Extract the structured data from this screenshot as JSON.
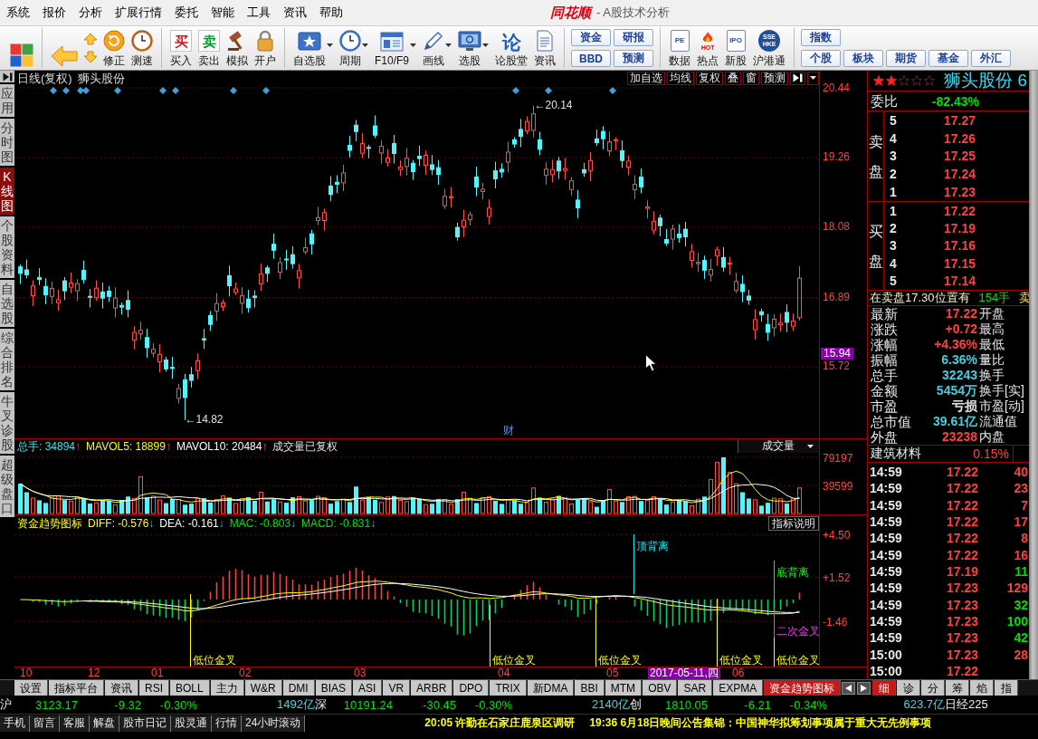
{
  "title_bar": {
    "logo": "同花顺",
    "title": "- A股技术分析"
  },
  "menu": [
    "系统",
    "报价",
    "分析",
    "扩展行情",
    "委托",
    "智能",
    "工具",
    "资讯",
    "帮助"
  ],
  "toolbar": [
    [
      {
        "kind": "icon"
      }
    ],
    [
      {
        "kind": "icon"
      },
      {
        "kind": "arrows"
      },
      {
        "kind": "labeled",
        "label": "修正",
        "caret": false
      },
      {
        "kind": "labeled",
        "label": "测速",
        "caret": false
      }
    ],
    [
      {
        "kind": "glyph",
        "glyph": "买",
        "label": "买入",
        "caret": false
      },
      {
        "kind": "glyph",
        "glyph": "卖",
        "label": "卖出",
        "caret": false
      },
      {
        "kind": "labeled",
        "label": "模拟",
        "caret": false
      },
      {
        "kind": "labeled",
        "label": "开户",
        "caret": false
      }
    ],
    [
      {
        "kind": "labeled",
        "label": "自选股",
        "caret": true
      },
      {
        "kind": "labeled",
        "label": "周期",
        "caret": true
      },
      {
        "kind": "labeled",
        "label": "F10/F9",
        "caret": true
      },
      {
        "kind": "labeled",
        "label": "画线",
        "caret": true
      },
      {
        "kind": "labeled",
        "label": "选股",
        "caret": true
      },
      {
        "kind": "glyph",
        "glyph": "论",
        "label": "论股堂",
        "caret": false
      },
      {
        "kind": "labeled",
        "label": "资讯",
        "caret": false
      }
    ],
    [
      {
        "kind": "pair",
        "labels": [
          "资金",
          "BBD"
        ]
      },
      {
        "kind": "pair",
        "labels": [
          "研报",
          "预测"
        ]
      }
    ],
    [
      {
        "kind": "glyph",
        "glyph": "PE",
        "label": "数据",
        "caret": false
      },
      {
        "kind": "glyph",
        "glyph": "HOT",
        "label": "热点",
        "caret": false
      },
      {
        "kind": "glyph",
        "glyph": "IPO",
        "label": "新股",
        "caret": false
      },
      {
        "kind": "glyph",
        "glyph": "SSE HKE",
        "label": "沪港通",
        "caret": false
      }
    ],
    [
      {
        "kind": "pair",
        "labels": [
          "指数",
          "个股"
        ]
      },
      {
        "kind": "text",
        "label": "板块"
      },
      {
        "kind": "text",
        "label": "期货"
      },
      {
        "kind": "text",
        "label": "基金"
      },
      {
        "kind": "text",
        "label": "外汇"
      }
    ]
  ],
  "sidebar": [
    {
      "label": "应用",
      "selected": false
    },
    {
      "label": "分时图",
      "selected": false
    },
    {
      "label": "K线图",
      "selected": true
    },
    {
      "label": "个股资料",
      "selected": false
    },
    {
      "label": "自选股",
      "selected": false
    },
    {
      "label": "综合排名",
      "selected": false
    },
    {
      "label": "牛叉诊股",
      "selected": false
    },
    {
      "label": "超级盘口",
      "selected": false
    }
  ],
  "chart": {
    "period": "日线(复权)",
    "stock": "狮头股份",
    "buttons": [
      "加自选",
      "均线",
      "复权",
      "叠",
      "窗",
      "预测"
    ],
    "price_ticks": [
      "20.44",
      "19.26",
      "18.08",
      "16.89",
      "15.72"
    ],
    "cursor_price": "15.94",
    "high_label": "←20.14",
    "low_label": "←14.82",
    "event_marker": "财"
  },
  "volume": {
    "legend": [
      {
        "text": "总手: 34894",
        "arrow": "↑",
        "color": "#40e0e8"
      },
      {
        "text": "MAVOL5: 18899",
        "arrow": "↑",
        "color": "#ffff00"
      },
      {
        "text": "MAVOL10: 20484",
        "arrow": "↑",
        "color": "#ffffff"
      }
    ],
    "note": "成交量已复权",
    "selector": "成交量",
    "ticks": [
      "79197",
      "39599"
    ]
  },
  "indicator": {
    "title": "资金趋势图标",
    "legend": [
      {
        "text": "DIFF: -0.576",
        "arrow": "↓",
        "color": "#ffff00"
      },
      {
        "text": "DEA: -0.161",
        "arrow": "↓",
        "color": "#ffffff"
      },
      {
        "text": "MAC: -0.803",
        "arrow": "↓",
        "color": "#00e000"
      },
      {
        "text": "MACD: -0.831",
        "arrow": "↓",
        "color": "#00e000"
      }
    ],
    "help": "指标说明",
    "ticks": [
      "+4.50",
      "+1.52",
      "-1.46"
    ],
    "signals": [
      {
        "kind": "low-golden-cross",
        "label": "低位金叉"
      },
      {
        "kind": "low-golden-cross",
        "label": "低位金叉"
      },
      {
        "kind": "low-golden-cross",
        "label": "低位金叉"
      },
      {
        "kind": "top-divergence",
        "label": "顶背离"
      },
      {
        "kind": "low-golden-cross",
        "label": "低位金叉"
      },
      {
        "kind": "bottom-divergence",
        "label": "底背离"
      },
      {
        "kind": "second-golden-cross",
        "label": "二次金叉"
      },
      {
        "kind": "low-golden-cross",
        "label": "低位金叉"
      }
    ]
  },
  "x_axis": {
    "labels": [
      "10",
      "12",
      "01",
      "02",
      "03",
      "04",
      "05",
      "06"
    ],
    "cursor_date": "2017-05-11,四"
  },
  "quote": {
    "stars": 2,
    "name": "狮头股份 6",
    "order_ratio": {
      "label": "委比",
      "value": "-82.43%"
    },
    "asks": {
      "label": "卖盘",
      "rows": [
        {
          "rank": "5",
          "price": "17.27"
        },
        {
          "rank": "4",
          "price": "17.26"
        },
        {
          "rank": "3",
          "price": "17.25"
        },
        {
          "rank": "2",
          "price": "17.24"
        },
        {
          "rank": "1",
          "price": "17.23"
        }
      ]
    },
    "bids": {
      "label": "买盘",
      "rows": [
        {
          "rank": "1",
          "price": "17.22"
        },
        {
          "rank": "2",
          "price": "17.19"
        },
        {
          "rank": "3",
          "price": "17.16"
        },
        {
          "rank": "4",
          "price": "17.15"
        },
        {
          "rank": "5",
          "price": "17.14"
        }
      ]
    },
    "queue": {
      "text": "在卖盘17.30位置有",
      "volume": "154手",
      "side": "卖"
    },
    "stats": [
      {
        "label": "最新",
        "value": "17.22",
        "color": "#ff4040",
        "extra": "开盘"
      },
      {
        "label": "涨跌",
        "value": "+0.72",
        "color": "#ff4040",
        "extra": "最高"
      },
      {
        "label": "涨幅",
        "value": "+4.36%",
        "color": "#ff4040",
        "extra": "最低"
      },
      {
        "label": "振幅",
        "value": "6.36%",
        "color": "#40d0e0",
        "extra": "量比"
      },
      {
        "label": "总手",
        "value": "32243",
        "color": "#40d0e0",
        "extra": "换手"
      },
      {
        "label": "金额",
        "value": "5454万",
        "color": "#40d0e0",
        "extra": "换手[实]"
      },
      {
        "label": "市盈",
        "value": "亏损",
        "color": "#e8e8e8",
        "extra": "市盈[动]"
      },
      {
        "label": "总市值",
        "value": "39.61亿",
        "color": "#40d0e0",
        "extra": "流通值"
      },
      {
        "label": "外盘",
        "value": "23238",
        "color": "#ff4040",
        "extra": "内盘"
      }
    ],
    "sector": {
      "name": "建筑材料",
      "change": "0.15%"
    },
    "ticks": [
      {
        "time": "14:59",
        "price": "17.22",
        "volume": "40",
        "color": "#ff4040"
      },
      {
        "time": "14:59",
        "price": "17.22",
        "volume": "23",
        "color": "#ff4040"
      },
      {
        "time": "14:59",
        "price": "17.22",
        "volume": "7",
        "color": "#ff4040"
      },
      {
        "time": "14:59",
        "price": "17.22",
        "volume": "17",
        "color": "#ff4040"
      },
      {
        "time": "14:59",
        "price": "17.22",
        "volume": "8",
        "color": "#ff4040"
      },
      {
        "time": "14:59",
        "price": "17.22",
        "volume": "16",
        "color": "#ff4040"
      },
      {
        "time": "14:59",
        "price": "17.19",
        "volume": "11",
        "color": "#00e000"
      },
      {
        "time": "14:59",
        "price": "17.23",
        "volume": "129",
        "color": "#ff4040"
      },
      {
        "time": "14:59",
        "price": "17.23",
        "volume": "32",
        "color": "#00e000"
      },
      {
        "time": "14:59",
        "price": "17.23",
        "volume": "100",
        "color": "#00e000"
      },
      {
        "time": "14:59",
        "price": "17.23",
        "volume": "42",
        "color": "#00e000"
      },
      {
        "time": "15:00",
        "price": "17.23",
        "volume": "28",
        "color": "#ff4040"
      },
      {
        "time": "15:00",
        "price": "17.22"
      }
    ]
  },
  "indicator_tabs": [
    {
      "label": "设置",
      "selected": false
    },
    {
      "label": "指标平台",
      "selected": false
    },
    {
      "label": "资讯",
      "selected": false
    },
    {
      "label": "RSI",
      "selected": false
    },
    {
      "label": "BOLL",
      "selected": false
    },
    {
      "label": "主力",
      "selected": false
    },
    {
      "label": "W&R",
      "selected": false
    },
    {
      "label": "DMI",
      "selected": false
    },
    {
      "label": "BIAS",
      "selected": false
    },
    {
      "label": "ASI",
      "selected": false
    },
    {
      "label": "VR",
      "selected": false
    },
    {
      "label": "ARBR",
      "selected": false
    },
    {
      "label": "DPO",
      "selected": false
    },
    {
      "label": "TRIX",
      "selected": false
    },
    {
      "label": "新DMA",
      "selected": false
    },
    {
      "label": "BBI",
      "selected": false
    },
    {
      "label": "MTM",
      "selected": false
    },
    {
      "label": "OBV",
      "selected": false
    },
    {
      "label": "SAR",
      "selected": false
    },
    {
      "label": "EXPMA",
      "selected": false
    },
    {
      "label": "资金趋势图标",
      "selected": true
    }
  ],
  "detail_tabs": [
    {
      "label": "细",
      "selected": true
    },
    {
      "label": "诊",
      "selected": false
    },
    {
      "label": "分",
      "selected": false
    },
    {
      "label": "筹",
      "selected": false
    },
    {
      "label": "焰",
      "selected": false
    },
    {
      "label": "指",
      "selected": false
    }
  ],
  "index_bar": [
    {
      "name": "沪",
      "value": "3123.17",
      "change": "-9.32",
      "percent": "-0.30%",
      "amount": "1492亿"
    },
    {
      "name": "深",
      "value": "10191.24",
      "change": "-30.45",
      "percent": "-0.30%",
      "amount": "2140亿"
    },
    {
      "name": "创",
      "value": "1810.05",
      "change": "-6.21",
      "percent": "-0.34%",
      "amount": "623.7亿"
    },
    {
      "name": "日经225"
    }
  ],
  "status_bar": {
    "links": [
      "手机",
      "留言",
      "客服",
      "解盘",
      "股市日记",
      "股灵通",
      "行情",
      "24小时滚动"
    ],
    "news": [
      "20:05 许勤在石家庄鹿泉区调研",
      "19:36 6月18日晚间公告集锦：中国神华拟筹划事项属于重大无先例事项"
    ]
  }
}
